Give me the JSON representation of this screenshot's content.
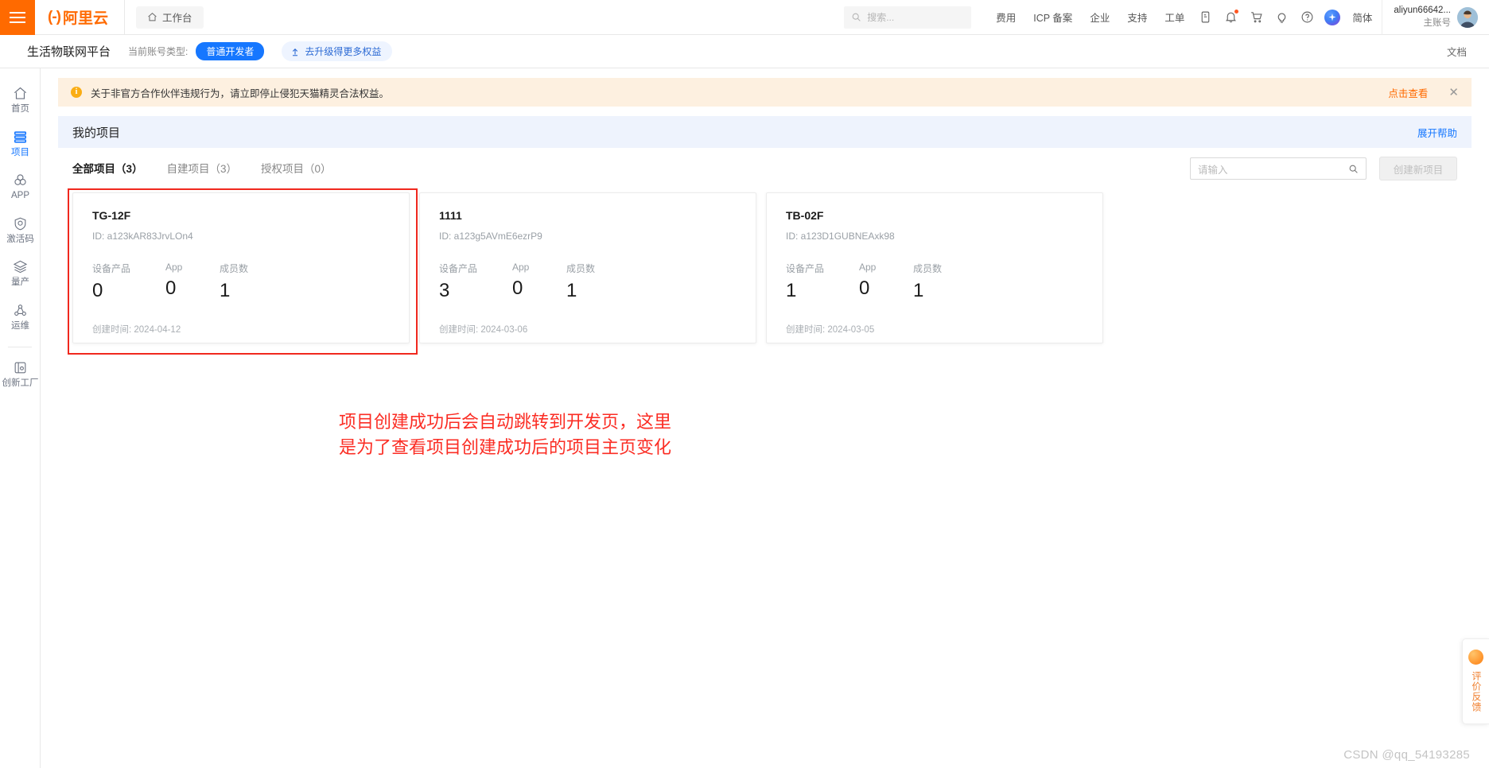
{
  "header": {
    "brand_mark": "(-)",
    "brand_text": "阿里云",
    "workbench_label": "工作台",
    "search_placeholder": "搜索...",
    "nav": [
      {
        "label": "费用"
      },
      {
        "label": "ICP 备案"
      },
      {
        "label": "企业"
      },
      {
        "label": "支持"
      },
      {
        "label": "工单"
      }
    ],
    "icons": [
      "mobile-icon",
      "bell-icon",
      "cart-icon",
      "bulb-icon",
      "help-icon",
      "globe-icon"
    ],
    "language": "简体",
    "account_name": "aliyun66642...",
    "account_role": "主账号"
  },
  "subheader": {
    "platform_title": "生活物联网平台",
    "account_type_label": "当前账号类型:",
    "account_type_value": "普通开发者",
    "upgrade_label": "去升级得更多权益",
    "doc_label": "文档"
  },
  "sidebar": {
    "items": [
      {
        "label": "首页",
        "icon": "home-icon",
        "active": false
      },
      {
        "label": "项目",
        "icon": "project-icon",
        "active": true
      },
      {
        "label": "APP",
        "icon": "app-icon",
        "active": false
      },
      {
        "label": "激活码",
        "icon": "activation-code-icon",
        "active": false
      },
      {
        "label": "量产",
        "icon": "mass-production-icon",
        "active": false
      },
      {
        "label": "运维",
        "icon": "operations-icon",
        "active": false
      },
      {
        "label": "创新工厂",
        "icon": "innovation-factory-icon",
        "active": false
      }
    ]
  },
  "alert": {
    "text": "关于非官方合作伙伴违规行为，请立即停止侵犯天猫精灵合法权益。",
    "action_label": "点击查看",
    "close_label": "✕"
  },
  "page": {
    "title": "我的项目",
    "help_label": "展开帮助"
  },
  "tabs": [
    {
      "label": "全部项目（3）",
      "active": true
    },
    {
      "label": "自建项目（3）",
      "active": false
    },
    {
      "label": "授权项目（0）",
      "active": false
    }
  ],
  "toolbar": {
    "search_placeholder": "请输入",
    "create_button_label": "创建新项目"
  },
  "card_labels": {
    "id_prefix": "ID: ",
    "devices": "设备产品",
    "app": "App",
    "members": "成员数",
    "created_prefix": "创建时间: "
  },
  "projects": [
    {
      "name": "TG-12F",
      "id": "ID: a123kAR83JrvLOn4",
      "devices": "0",
      "app": "0",
      "members": "1",
      "created": "创建时间: 2024-04-12",
      "highlighted": true
    },
    {
      "name": "1111",
      "id": "ID: a123g5AVmE6ezrP9",
      "devices": "3",
      "app": "0",
      "members": "1",
      "created": "创建时间: 2024-03-06",
      "highlighted": false
    },
    {
      "name": "TB-02F",
      "id": "ID: a123D1GUBNEAxk98",
      "devices": "1",
      "app": "0",
      "members": "1",
      "created": "创建时间: 2024-03-05",
      "highlighted": false
    }
  ],
  "annotation": {
    "line1": "项目创建成功后会自动跳转到开发页，这里",
    "line2": "是为了查看项目创建成功后的项目主页变化",
    "color": "#fb2d24"
  },
  "feedback": {
    "text": "评价反馈"
  },
  "watermark": {
    "text": "CSDN @qq_54193285"
  },
  "colors": {
    "brand_orange": "#ff6a00",
    "primary_blue": "#1677ff",
    "alert_bg": "#fdf0e0",
    "title_band_bg": "#eef3fd",
    "annotation_red": "#fb2d24"
  }
}
